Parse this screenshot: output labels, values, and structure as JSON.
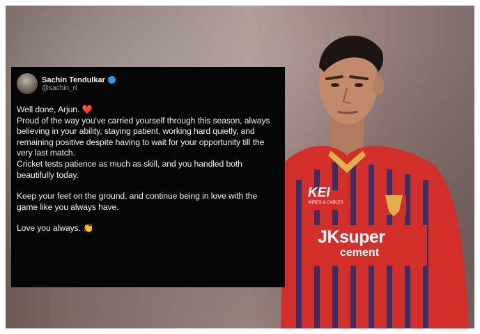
{
  "tweet": {
    "author_name": "Sachin Tendulkar",
    "handle": "@sachin_rt",
    "line1": "Well done, Arjun.",
    "line1_emoji": "❤️",
    "para1": "Proud of the way you've carried yourself through this season, always believing in your ability, staying patient, working hard quietly, and remaining positive despite having to wait for your opportunity till the very last match.",
    "para2": "Cricket tests patience as much as skill, and you handled both beautifully today.",
    "para3": "Keep your feet on the ground, and continue being in love with the game like you always have.",
    "para4": "Love you always.",
    "para4_emoji": "👏"
  },
  "jersey": {
    "sponsor1": "KEI",
    "sponsor1_sub": "WIRES & CABLES",
    "sponsor2": "JKsuper",
    "sponsor2_sub": "cement"
  },
  "colors": {
    "jersey_red": "#d22f2a",
    "jersey_stripe": "#2d2f6a",
    "tweet_bg": "#050505",
    "verified": "#1d9bf0"
  }
}
